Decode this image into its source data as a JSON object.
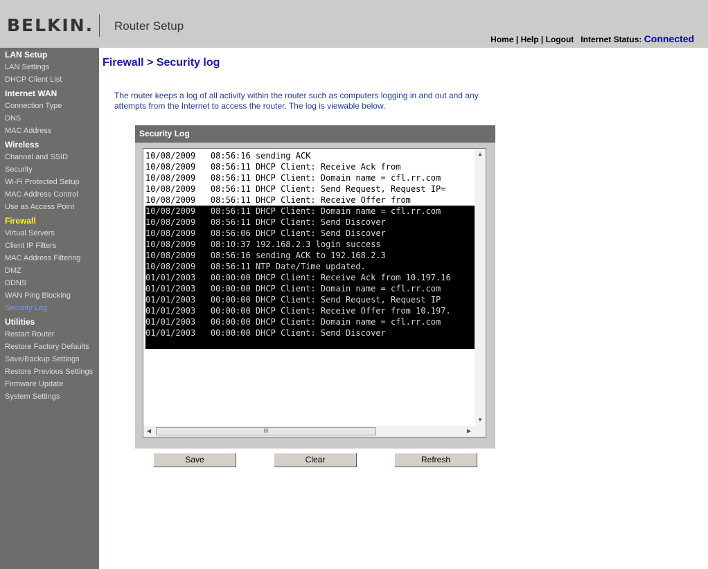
{
  "header": {
    "logo": "BELKIN.",
    "app_title": "Router Setup",
    "nav": {
      "home": "Home",
      "help": "Help",
      "logout": "Logout",
      "sep": "|"
    },
    "status_label": "Internet Status:",
    "status_value": "Connected"
  },
  "sidebar": [
    {
      "title": "LAN Setup",
      "items": [
        "LAN Settings",
        "DHCP Client List"
      ]
    },
    {
      "title": "Internet WAN",
      "items": [
        "Connection Type",
        "DNS",
        "MAC Address"
      ]
    },
    {
      "title": "Wireless",
      "items": [
        "Channel and SSID",
        "Security",
        "Wi-Fi Protected Setup",
        "MAC Address Control",
        "Use as Access Point"
      ]
    },
    {
      "title": "Firewall",
      "items": [
        "Virtual Servers",
        "Client IP Filters",
        "MAC Address Filtering",
        "DMZ",
        "DDNS",
        "WAN Ping Blocking",
        "Security Log"
      ]
    },
    {
      "title": "Utilities",
      "items": [
        "Restart Router",
        "Restore Factory Defaults",
        "Save/Backup Settings",
        "Restore Previous Settings",
        "Firmware Update",
        "System Settings"
      ]
    }
  ],
  "page": {
    "title": "Firewall > Security log",
    "intro": "The router keeps a log of all activity within the router such as computers logging in and out and any attempts from the Internet to access the router. The log is viewable below."
  },
  "log": {
    "panel_title": "Security Log",
    "lines": [
      "10/08/2009   08:56:16 sending ACK",
      "10/08/2009   08:56:11 DHCP Client: Receive Ack from",
      "10/08/2009   08:56:11 DHCP Client: Domain name = cfl.rr.com",
      "10/08/2009   08:56:11 DHCP Client: Send Request, Request IP=",
      "10/08/2009   08:56:11 DHCP Client: Receive Offer from",
      "10/08/2009   08:56:11 DHCP Client: Domain name = cfl.rr.com",
      "10/08/2009   08:56:11 DHCP Client: Send Discover",
      "10/08/2009   08:56:06 DHCP Client: Send Discover",
      "10/08/2009   08:10:37 192.168.2.3 login success",
      "10/08/2009   08:56:16 sending ACK to 192.168.2.3",
      "10/08/2009   08:56:11 NTP Date/Time updated.",
      "01/01/2003   00:00:00 DHCP Client: Receive Ack from 10.197.16",
      "01/01/2003   00:00:00 DHCP Client: Domain name = cfl.rr.com",
      "01/01/2003   00:00:00 DHCP Client: Send Request, Request IP",
      "01/01/2003   00:00:00 DHCP Client: Receive Offer from 10.197.",
      "01/01/2003   00:00:00 DHCP Client: Domain name = cfl.rr.com",
      "01/01/2003   00:00:00 DHCP Client: Send Discover"
    ]
  },
  "buttons": {
    "save": "Save",
    "clear": "Clear",
    "refresh": "Refresh"
  },
  "scrollbar": {
    "thumb_grip": "III",
    "up": "▲",
    "down": "▼",
    "left": "◀",
    "right": "▶"
  },
  "colors": {
    "header_bg": "#cbcbcb",
    "sidebar_bg": "#6f6d6b",
    "title_blue": "#1919a6",
    "status_blue": "#0000cc",
    "firewall_yellow": "#f7f31c",
    "active_link": "#6e9cff"
  }
}
